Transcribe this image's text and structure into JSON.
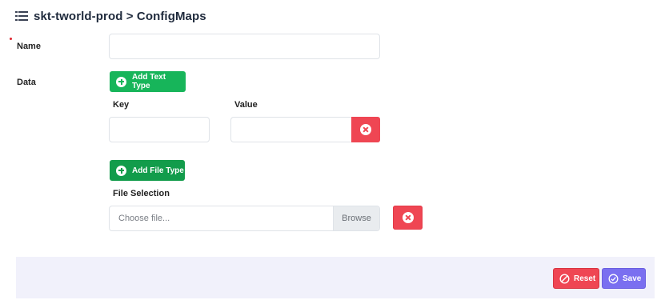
{
  "header": {
    "title": "skt-tworld-prod > ConfigMaps",
    "icon": "list-icon"
  },
  "form": {
    "name_label": "Name",
    "name_value": "",
    "data_label": "Data",
    "add_text_label": "Add Text Type",
    "key_label": "Key",
    "value_label": "Value",
    "key_value": "",
    "value_value": "",
    "add_file_label": "Add File Type",
    "file_selection_label": "File Selection",
    "file_placeholder": "Choose file...",
    "browse_label": "Browse"
  },
  "footer": {
    "reset_label": "Reset",
    "save_label": "Save"
  },
  "colors": {
    "green": "#17b55a",
    "red": "#ef4653",
    "purple": "#7a6ff0",
    "footer_bg": "#f1f1fb"
  }
}
